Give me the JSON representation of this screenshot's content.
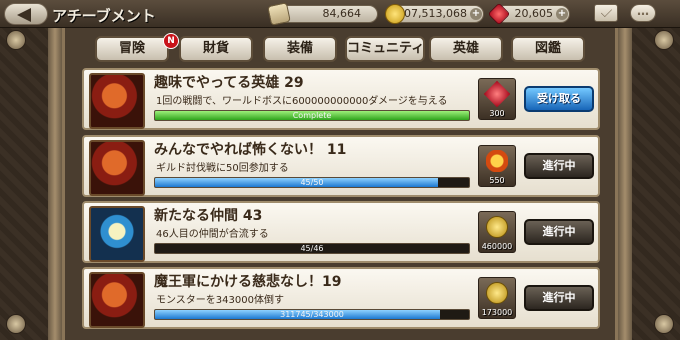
{
  "header": {
    "title": "アチーブメント",
    "scrolls": "84,664",
    "gold": "507,513,068",
    "gems": "20,605",
    "plus": "+"
  },
  "tabs": [
    {
      "label": "冒険",
      "active": true
    },
    {
      "label": "財貨"
    },
    {
      "label": "装備"
    },
    {
      "label": "コミュニティ"
    },
    {
      "label": "英雄"
    },
    {
      "label": "図鑑"
    }
  ],
  "tab_badge": "N",
  "achievements": [
    {
      "title": "趣味でやってる英雄 29",
      "desc": "1回の戦闘で、ワールドボスに600000000000ダメージを与える",
      "progress_text": "Complete",
      "progress": 1.0,
      "reward_icon": "gem-icon",
      "reward_count": "300",
      "status": "受け取る"
    },
    {
      "title": "みんなでやれば怖くない！ 11",
      "desc": "ギルド討伐戦に50回参加する",
      "progress_text": "45/50",
      "progress": 0.9,
      "reward_icon": "burst-icon",
      "reward_count": "550",
      "status": "進行中"
    },
    {
      "title": "新たなる仲間 43",
      "desc": "46人目の仲間が合流する",
      "progress_text": "45/46",
      "progress": 0.978,
      "reward_icon": "coin-icon",
      "reward_count": "460000",
      "status": "進行中"
    },
    {
      "title": "魔王軍にかける慈悲なし！19",
      "desc": "モンスターを343000体倒す",
      "progress_text": "311745/343000",
      "progress": 0.909,
      "reward_icon": "coin-icon",
      "reward_count": "173000",
      "status": "進行中"
    }
  ],
  "colors": {
    "complete": "#2fa41c",
    "progress": "#1c78d0",
    "claim": "#1866b8"
  }
}
